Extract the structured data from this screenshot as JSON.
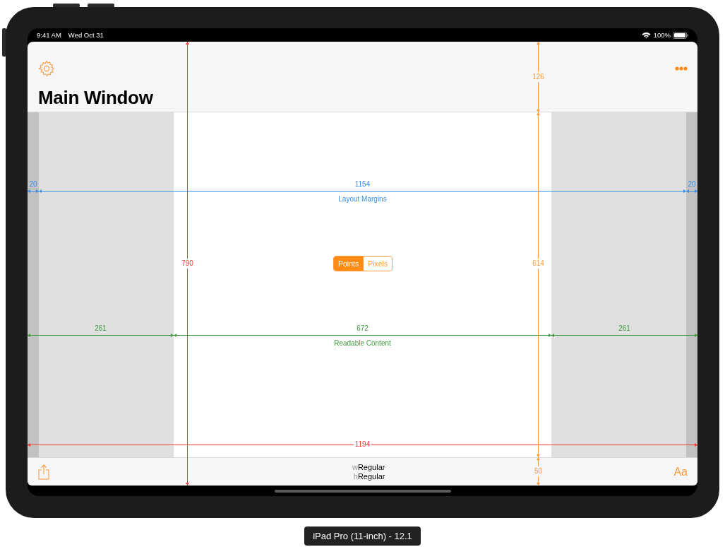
{
  "status_bar": {
    "time": "9:41 AM",
    "date": "Wed Oct 31",
    "battery": "100%"
  },
  "nav_bar": {
    "title": "Main Window"
  },
  "unit_toggle": [
    {
      "label": "Points",
      "selected": true
    },
    {
      "label": "Pixels",
      "selected": false
    }
  ],
  "horizontal_guides": [
    {
      "kind": "layout",
      "caption": "Layout Margins",
      "segments": [
        "20",
        "1154",
        "20"
      ]
    },
    {
      "kind": "readable",
      "caption": "Readable Content",
      "segments": [
        "261",
        "672",
        "261"
      ]
    },
    {
      "kind": "screen",
      "segments": [
        "1194"
      ]
    }
  ],
  "vertical_guides": [
    {
      "kind": "screen",
      "segments": [
        "790"
      ]
    },
    {
      "kind": "safe",
      "segments": [
        "126",
        "614",
        "50"
      ]
    }
  ],
  "toolbar": {
    "size_classes": [
      {
        "prefix": "w",
        "value": "Regular"
      },
      {
        "prefix": "h",
        "value": "Regular"
      }
    ],
    "text_button": "Aa"
  },
  "device_label": "iPad Pro (11-inch) - 12.1"
}
